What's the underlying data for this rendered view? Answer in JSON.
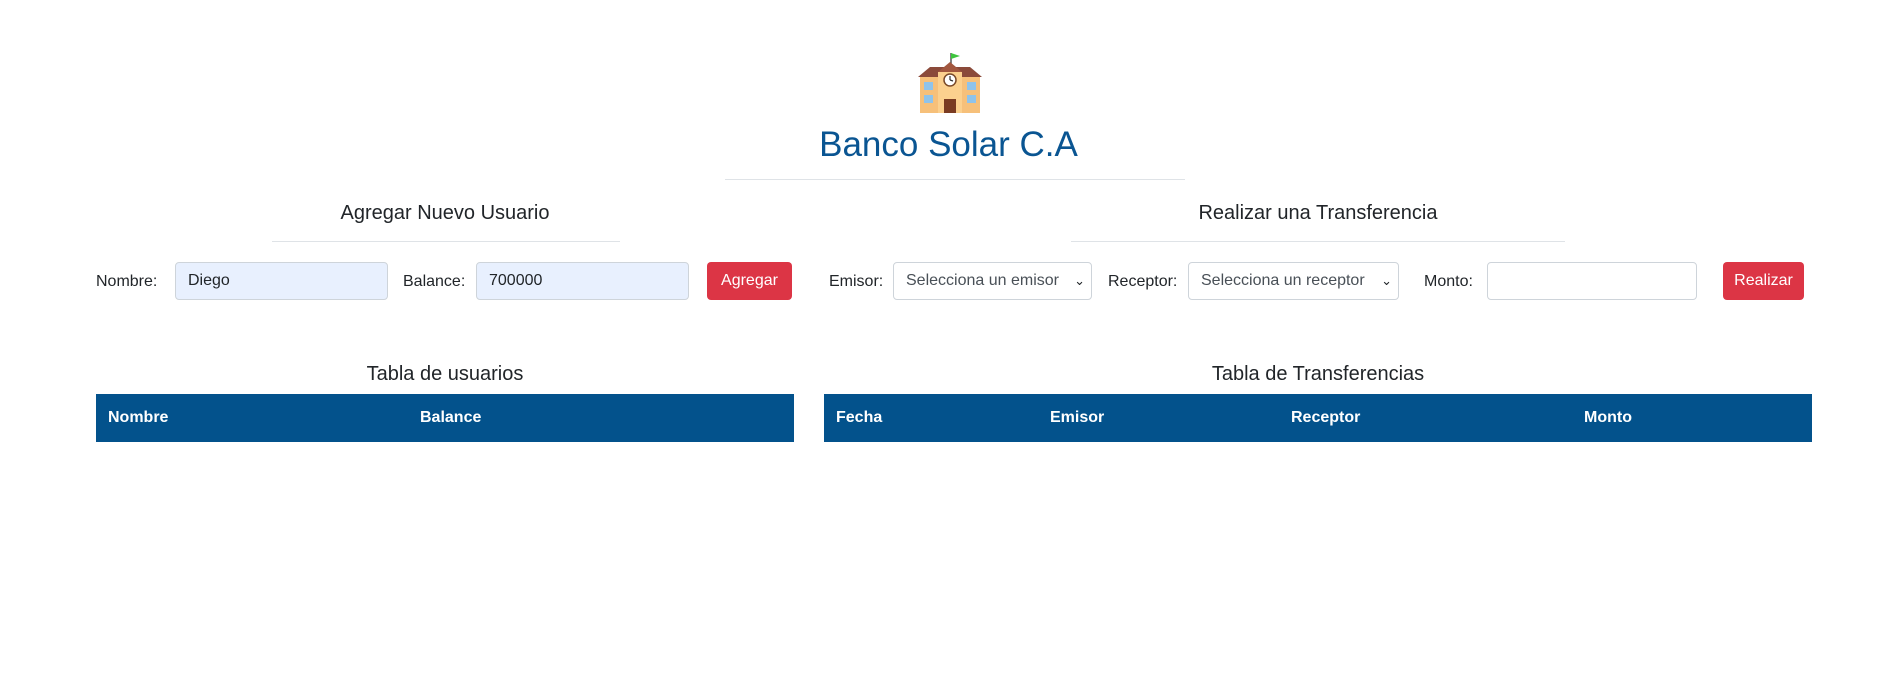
{
  "header": {
    "title": "Banco Solar C.A",
    "logo_icon": "school-building-icon"
  },
  "add_user": {
    "title": "Agregar Nuevo Usuario",
    "nombre_label": "Nombre:",
    "nombre_value": "Diego",
    "balance_label": "Balance:",
    "balance_value": "700000",
    "button_label": "Agregar"
  },
  "transfer": {
    "title": "Realizar una Transferencia",
    "emisor_label": "Emisor:",
    "emisor_selected": "Selecciona un emisor",
    "receptor_label": "Receptor:",
    "receptor_selected": "Selecciona un receptor",
    "monto_label": "Monto:",
    "monto_value": "",
    "button_label": "Realizar"
  },
  "users_table": {
    "title": "Tabla de usuarios",
    "columns": [
      "Nombre",
      "Balance"
    ],
    "rows": []
  },
  "transfers_table": {
    "title": "Tabla de Transferencias",
    "columns": [
      "Fecha",
      "Emisor",
      "Receptor",
      "Monto"
    ],
    "rows": []
  },
  "colors": {
    "brand": "#0a5592",
    "table_header": "#03528c",
    "danger": "#dc3545"
  }
}
